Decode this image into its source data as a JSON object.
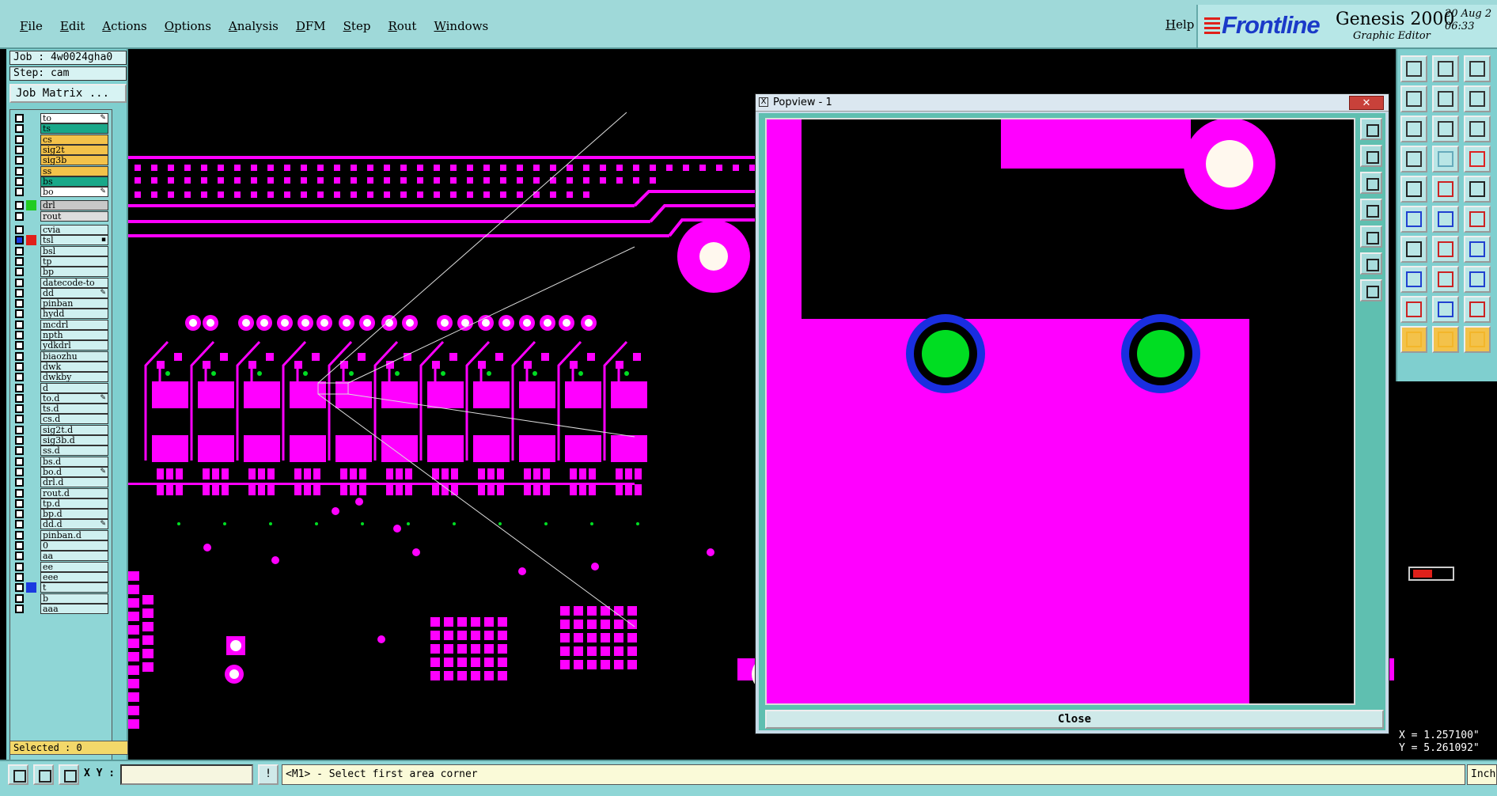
{
  "menubar": {
    "items": [
      "File",
      "Edit",
      "Actions",
      "Options",
      "Analysis",
      "DFM",
      "Step",
      "Rout",
      "Windows"
    ],
    "help": "Help"
  },
  "brand": {
    "logo": "Frontline",
    "title": "Genesis 2000",
    "subtitle": "Graphic Editor",
    "date": "20 Aug 2\n06:33"
  },
  "left": {
    "job": "Job : 4w0024gha0",
    "step": "Step: cam",
    "job_matrix": "Job Matrix ...",
    "selected": "Selected : 0",
    "layers": [
      {
        "name": "to",
        "bg": "#ffffff",
        "mark": "✎"
      },
      {
        "name": "ts",
        "bg": "#19a889",
        "mark": ""
      },
      {
        "name": "cs",
        "bg": "#f3c24a",
        "mark": ""
      },
      {
        "name": "sig2t",
        "bg": "#f3c24a",
        "mark": ""
      },
      {
        "name": "sig3b",
        "bg": "#f3c24a",
        "mark": ""
      },
      {
        "name": "ss",
        "bg": "#f3c24a",
        "mark": ""
      },
      {
        "name": "bs",
        "bg": "#19a889",
        "mark": ""
      },
      {
        "name": "bo",
        "bg": "#ffffff",
        "mark": "✎"
      },
      {
        "name": "drl",
        "bg": "#c8c8c8",
        "mark": "",
        "swatch": "#22cc22",
        "gap": true
      },
      {
        "name": "rout",
        "bg": "#dddddd",
        "mark": ""
      },
      {
        "name": "cvia",
        "bg": "#cff0f0",
        "mark": "",
        "gap": true
      },
      {
        "name": "tsl",
        "bg": "#cff0f0",
        "mark": "▪",
        "swatch": "#e0201a",
        "checked": true
      },
      {
        "name": "bsl",
        "bg": "#cff0f0",
        "mark": ""
      },
      {
        "name": "tp",
        "bg": "#cff0f0",
        "mark": ""
      },
      {
        "name": "bp",
        "bg": "#cff0f0",
        "mark": ""
      },
      {
        "name": "datecode-to",
        "bg": "#cff0f0",
        "mark": ""
      },
      {
        "name": "dd",
        "bg": "#cff0f0",
        "mark": "✎"
      },
      {
        "name": "pinban",
        "bg": "#cff0f0",
        "mark": ""
      },
      {
        "name": "hydd",
        "bg": "#cff0f0",
        "mark": ""
      },
      {
        "name": "mcdrl",
        "bg": "#cff0f0",
        "mark": ""
      },
      {
        "name": "npth",
        "bg": "#cff0f0",
        "mark": ""
      },
      {
        "name": "ydkdrl",
        "bg": "#cff0f0",
        "mark": ""
      },
      {
        "name": "biaozhu",
        "bg": "#cff0f0",
        "mark": ""
      },
      {
        "name": "dwk",
        "bg": "#cff0f0",
        "mark": ""
      },
      {
        "name": "dwkby",
        "bg": "#cff0f0",
        "mark": ""
      },
      {
        "name": "d",
        "bg": "#cff0f0",
        "mark": ""
      },
      {
        "name": "to.d",
        "bg": "#cff0f0",
        "mark": "✎"
      },
      {
        "name": "ts.d",
        "bg": "#cff0f0",
        "mark": ""
      },
      {
        "name": "cs.d",
        "bg": "#cff0f0",
        "mark": ""
      },
      {
        "name": "sig2t.d",
        "bg": "#cff0f0",
        "mark": ""
      },
      {
        "name": "sig3b.d",
        "bg": "#cff0f0",
        "mark": ""
      },
      {
        "name": "ss.d",
        "bg": "#cff0f0",
        "mark": ""
      },
      {
        "name": "bs.d",
        "bg": "#cff0f0",
        "mark": ""
      },
      {
        "name": "bo.d",
        "bg": "#cff0f0",
        "mark": "✎"
      },
      {
        "name": "drl.d",
        "bg": "#cff0f0",
        "mark": ""
      },
      {
        "name": "rout.d",
        "bg": "#cff0f0",
        "mark": ""
      },
      {
        "name": "tp.d",
        "bg": "#cff0f0",
        "mark": ""
      },
      {
        "name": "bp.d",
        "bg": "#cff0f0",
        "mark": ""
      },
      {
        "name": "dd.d",
        "bg": "#cff0f0",
        "mark": "✎"
      },
      {
        "name": "pinban.d",
        "bg": "#cff0f0",
        "mark": ""
      },
      {
        "name": "0",
        "bg": "#cff0f0",
        "mark": ""
      },
      {
        "name": "aa",
        "bg": "#cff0f0",
        "mark": ""
      },
      {
        "name": "ee",
        "bg": "#cff0f0",
        "mark": ""
      },
      {
        "name": "eee",
        "bg": "#cff0f0",
        "mark": ""
      },
      {
        "name": "t",
        "bg": "#cff0f0",
        "mark": "",
        "swatch": "#1a3ae0"
      },
      {
        "name": "b",
        "bg": "#cff0f0",
        "mark": ""
      },
      {
        "name": "aaa",
        "bg": "#cff0f0",
        "mark": ""
      }
    ]
  },
  "popview": {
    "title": "Popview - 1",
    "close_x": "✕",
    "close_button": "Close"
  },
  "colors": {
    "copper": "#ff00ff",
    "drill": "#00dd22",
    "ring": "#1a2ee0",
    "pad_hole": "#fff8ee"
  },
  "right": {
    "coord_x": "X = 1.257100\"",
    "coord_y": "Y = 5.261092\""
  },
  "status": {
    "xy_label": "X Y :",
    "xy_value": "",
    "prompt": "<M1> - Select first area corner",
    "units": "Inch"
  }
}
